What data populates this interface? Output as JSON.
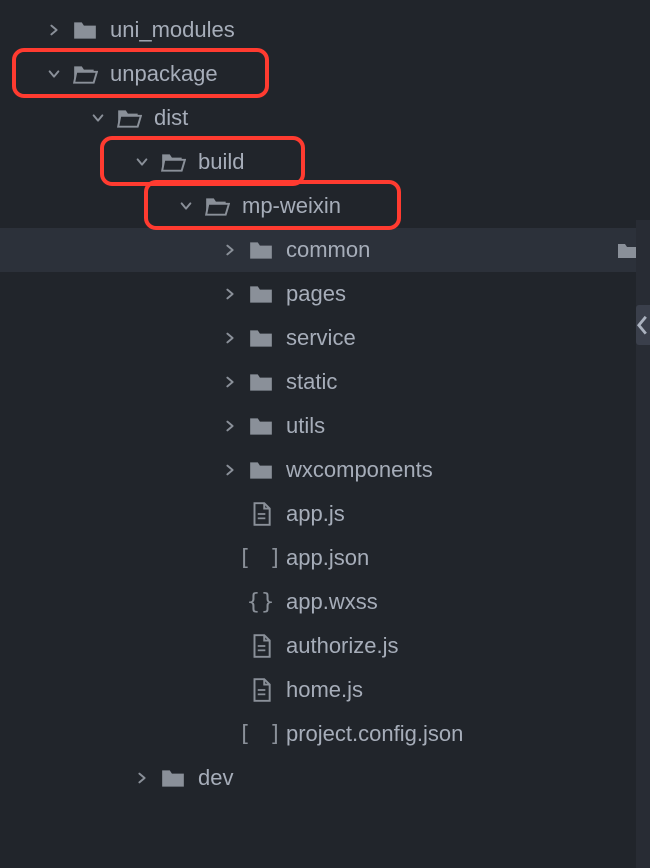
{
  "tree": [
    {
      "id": "uni_modules",
      "label": "uni_modules",
      "type": "folder",
      "expanded": false,
      "indent": 46,
      "highlighted": false,
      "selected": false
    },
    {
      "id": "unpackage",
      "label": "unpackage",
      "type": "folder-open",
      "expanded": true,
      "indent": 46,
      "highlighted": true,
      "selected": false
    },
    {
      "id": "dist",
      "label": "dist",
      "type": "folder-open",
      "expanded": true,
      "indent": 90,
      "highlighted": false,
      "selected": false
    },
    {
      "id": "build",
      "label": "build",
      "type": "folder-open",
      "expanded": true,
      "indent": 134,
      "highlighted": true,
      "selected": false
    },
    {
      "id": "mp-weixin",
      "label": "mp-weixin",
      "type": "folder-open",
      "expanded": true,
      "indent": 178,
      "highlighted": true,
      "selected": false
    },
    {
      "id": "common",
      "label": "common",
      "type": "folder",
      "expanded": false,
      "indent": 222,
      "highlighted": false,
      "selected": true,
      "trailingIcon": "folder"
    },
    {
      "id": "pages",
      "label": "pages",
      "type": "folder",
      "expanded": false,
      "indent": 222,
      "highlighted": false,
      "selected": false
    },
    {
      "id": "service",
      "label": "service",
      "type": "folder",
      "expanded": false,
      "indent": 222,
      "highlighted": false,
      "selected": false
    },
    {
      "id": "static",
      "label": "static",
      "type": "folder",
      "expanded": false,
      "indent": 222,
      "highlighted": false,
      "selected": false
    },
    {
      "id": "utils",
      "label": "utils",
      "type": "folder",
      "expanded": false,
      "indent": 222,
      "highlighted": false,
      "selected": false
    },
    {
      "id": "wxcomponents",
      "label": "wxcomponents",
      "type": "folder",
      "expanded": false,
      "indent": 222,
      "highlighted": false,
      "selected": false
    },
    {
      "id": "app-js",
      "label": "app.js",
      "type": "file-js",
      "expanded": null,
      "indent": 222,
      "highlighted": false,
      "selected": false
    },
    {
      "id": "app-json",
      "label": "app.json",
      "type": "file-json",
      "expanded": null,
      "indent": 222,
      "highlighted": false,
      "selected": false
    },
    {
      "id": "app-wxss",
      "label": "app.wxss",
      "type": "file-wxss",
      "expanded": null,
      "indent": 222,
      "highlighted": false,
      "selected": false
    },
    {
      "id": "authorize-js",
      "label": "authorize.js",
      "type": "file-js",
      "expanded": null,
      "indent": 222,
      "highlighted": false,
      "selected": false
    },
    {
      "id": "home-js",
      "label": "home.js",
      "type": "file-js",
      "expanded": null,
      "indent": 222,
      "highlighted": false,
      "selected": false
    },
    {
      "id": "project-config",
      "label": "project.config.json",
      "type": "file-json",
      "expanded": null,
      "indent": 222,
      "highlighted": false,
      "selected": false
    },
    {
      "id": "dev",
      "label": "dev",
      "type": "folder",
      "expanded": false,
      "indent": 134,
      "highlighted": false,
      "selected": false
    }
  ],
  "colors": {
    "background": "#21252b",
    "text": "#abb2bf",
    "icon": "#6f7681",
    "selected": "#2c313a",
    "highlight": "#ff3b30"
  }
}
